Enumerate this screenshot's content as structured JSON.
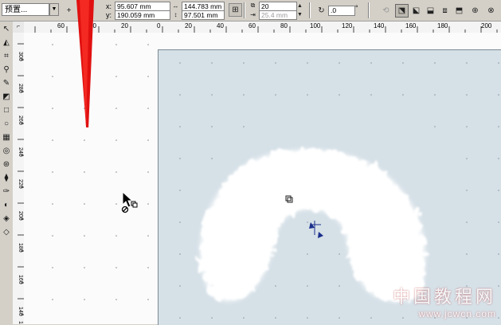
{
  "toolbar": {
    "preset": "预置...",
    "x_label": "x:",
    "x_value": "95.607 mm",
    "y_label": "y:",
    "y_value": "190.059 mm",
    "width_value": "144.783 mm",
    "height_value": "97.501 mm",
    "steps_value": "20",
    "offset_value": "25.4 mm",
    "angle_value": ".0",
    "degree_symbol": "°"
  },
  "hruler": {
    "ticks": [
      "60",
      "40",
      "20",
      "0",
      "20",
      "40",
      "60",
      "80",
      "100",
      "120",
      "140",
      "160",
      "180",
      "200"
    ]
  },
  "vruler": {
    "ticks": [
      "300",
      "280",
      "260",
      "240",
      "220",
      "200",
      "180",
      "160",
      "140",
      "120"
    ]
  },
  "watermark": {
    "title": "中国教程网",
    "url": "www.jcwcn.com"
  },
  "colors": {
    "page": "#d5e0e7",
    "canvas": "#fbfbfb",
    "arrow": "#e01010",
    "fur": "#ffffff"
  }
}
